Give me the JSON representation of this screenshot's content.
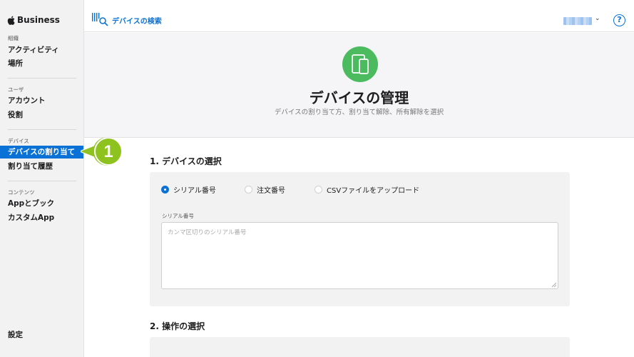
{
  "sidebar": {
    "brand": "Business",
    "sections": [
      {
        "label": "組織",
        "items": [
          "アクティビティ",
          "場所"
        ]
      },
      {
        "label": "ユーザ",
        "items": [
          "アカウント",
          "役割"
        ]
      },
      {
        "label": "デバイス",
        "items": [
          "デバイスの割り当て",
          "割り当て履歴"
        ]
      },
      {
        "label": "コンテンツ",
        "items": [
          "Appとブック",
          "カスタムApp"
        ]
      }
    ],
    "settings": "設定",
    "active_item": "デバイスの割り当て"
  },
  "callout": {
    "number": "1",
    "color": "#8ec21f"
  },
  "header": {
    "search_label": "デバイスの検索",
    "help_label": "?"
  },
  "hero": {
    "title": "デバイスの管理",
    "subtitle": "デバイスの割り当て方、割り当て解除、所有解除を選択",
    "icon": "devices-icon"
  },
  "section1": {
    "title": "1. デバイスの選択",
    "options": [
      "シリアル番号",
      "注文番号",
      "CSVファイルをアップロード"
    ],
    "selected": "シリアル番号",
    "field_label": "シリアル番号",
    "field_placeholder": "カンマ区切りのシリアル番号"
  },
  "section2": {
    "title": "2. 操作の選択"
  },
  "colors": {
    "accent": "#0a72d6",
    "hero_icon": "#4cbb5f",
    "sidebar_bg": "#f2f2f2"
  }
}
